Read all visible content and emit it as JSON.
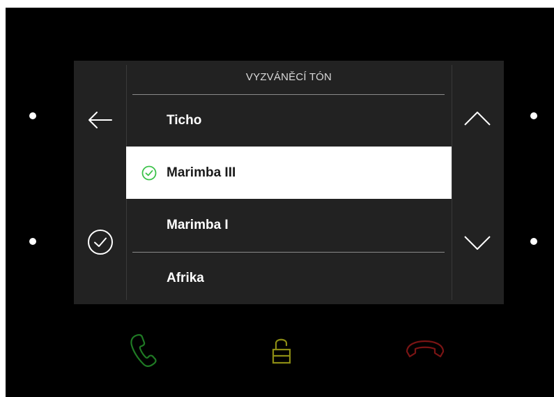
{
  "screen": {
    "title": "VYZVÁNĚCÍ TÓN",
    "items": [
      {
        "label": "Ticho",
        "selected": false
      },
      {
        "label": "Marimba III",
        "selected": true
      },
      {
        "label": "Marimba I",
        "selected": false
      },
      {
        "label": "Afrika",
        "selected": false
      }
    ]
  },
  "icons": {
    "back": "arrow-left-icon",
    "confirm": "check-circle-icon",
    "scroll_up": "chevron-up-icon",
    "scroll_down": "chevron-down-icon",
    "selected": "check-circle-icon",
    "answer": "phone-answer-icon",
    "unlock": "padlock-open-icon",
    "hangup": "phone-hangup-icon"
  },
  "colors": {
    "device": "#000000",
    "screen": "#222222",
    "selected_row": "#ffffff",
    "selected_check": "#3cc24a",
    "answer": "#1f7a24",
    "unlock": "#8c8c14",
    "hangup": "#7a1414"
  }
}
